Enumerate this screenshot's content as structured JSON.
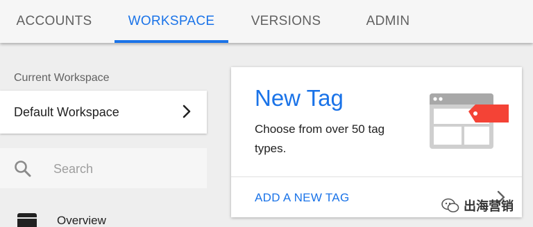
{
  "tabs": {
    "accounts": "ACCOUNTS",
    "workspace": "WORKSPACE",
    "versions": "VERSIONS",
    "admin": "ADMIN",
    "active": "WORKSPACE"
  },
  "sidebar": {
    "current_workspace_label": "Current Workspace",
    "workspace_name": "Default Workspace",
    "search_placeholder": "Search",
    "nav_items": [
      {
        "label": "Overview",
        "icon": "overview-icon"
      }
    ]
  },
  "new_tag_card": {
    "title": "New Tag",
    "description": "Choose from over 50 tag types.",
    "action_label": "ADD A NEW TAG",
    "illustration": "tag-template-icon"
  },
  "watermark": {
    "text": "出海营销",
    "icon": "wechat-icon"
  },
  "colors": {
    "accent": "#1a73e8",
    "tab_text": "#616161",
    "background": "#eeeeee",
    "card": "#ffffff",
    "tag_red": "#f44336",
    "illustration_gray": "#bdbdbd"
  }
}
